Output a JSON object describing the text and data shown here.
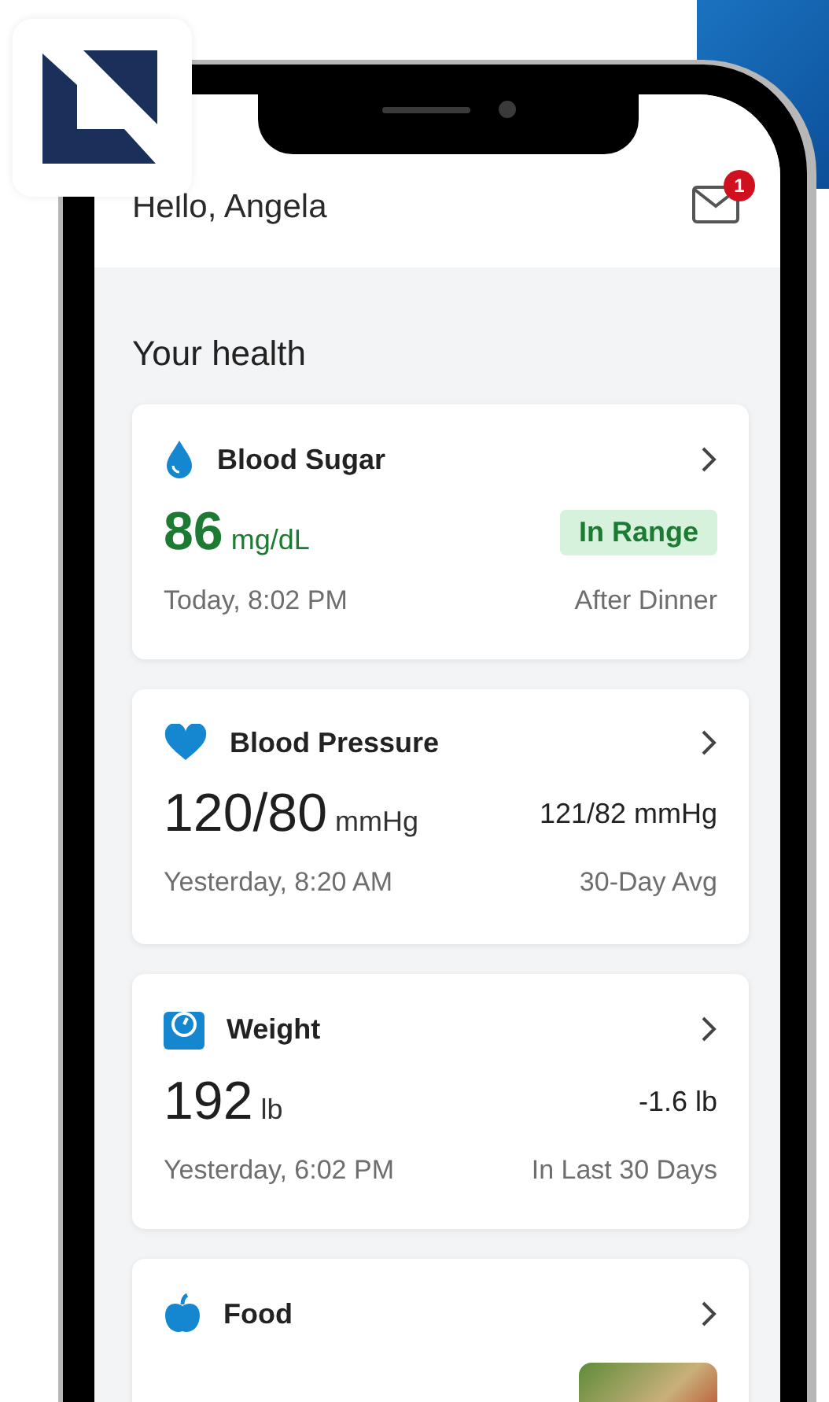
{
  "header": {
    "greeting": "Hello, Angela",
    "mail_badge": "1"
  },
  "section_title": "Your health",
  "cards": [
    {
      "kind": "badge",
      "title": "Blood Sugar",
      "value": "86",
      "unit": "mg/dL",
      "badge": "In Range",
      "time": "Today, 8:02 PM",
      "note": "After Dinner"
    },
    {
      "kind": "plain",
      "title": "Blood Pressure",
      "value": "120/80",
      "unit": "mmHg",
      "reading": "121/82 mmHg",
      "time": "Yesterday, 8:20 AM",
      "note": "30-Day Avg"
    },
    {
      "kind": "plain",
      "title": "Weight",
      "value": "192",
      "unit": "lb",
      "reading": "-1.6 lb",
      "time": "Yesterday, 6:02 PM",
      "note": "In Last 30 Days"
    },
    {
      "kind": "photo",
      "title": "Food"
    }
  ]
}
